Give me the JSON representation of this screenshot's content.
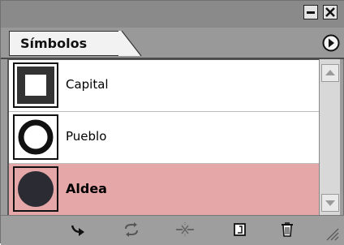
{
  "panel": {
    "tab_label": "Símbolos",
    "symbols": [
      {
        "label": "Capital",
        "icon": "square-in-square-icon",
        "selected": false
      },
      {
        "label": "Pueblo",
        "icon": "ring-icon",
        "selected": false
      },
      {
        "label": "Aldea",
        "icon": "filled-circle-icon",
        "selected": true
      }
    ]
  },
  "colors": {
    "selected_row": "#e5a7a7",
    "panel_gray": "#9c9c9c"
  }
}
